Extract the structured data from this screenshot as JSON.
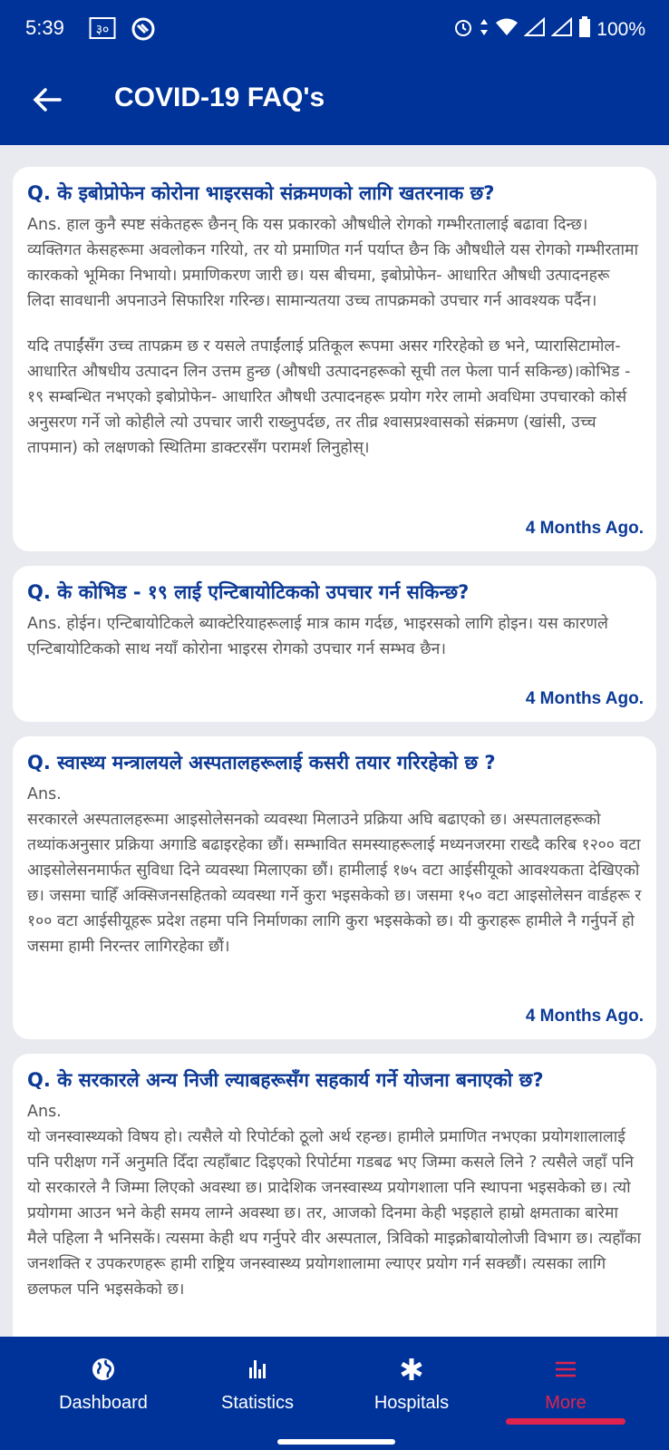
{
  "status": {
    "time": "5:39",
    "battery": "100%"
  },
  "appbar": {
    "title": "COVID-19 FAQ's"
  },
  "faqs": [
    {
      "question": "Q. के इबोप्रोफेन कोरोना भाइरसको संक्रमणको लागि खतरनाक छ?",
      "paragraphs": [
        "Ans. हाल कुनै स्पष्ट संकेतहरू छैनन् कि यस प्रकारको औषधीले रोगको गम्भीरतालाई बढावा दिन्छ। व्यक्तिगत केसहरूमा अवलोकन गरियो, तर यो प्रमाणित गर्न पर्याप्त छैन कि औषधीले यस रोगको गम्भीरतामा कारकको भूमिका निभायो। प्रमाणिकरण जारी छ। यस बीचमा, इबोप्रोफेन- आधारित औषधी उत्पादनहरू लिदा सावधानी अपनाउने सिफारिश गरिन्छ। सामान्यतया उच्च तापक्रमको उपचार गर्न आवश्यक पर्दैन।",
        "यदि तपाईंसँग उच्च तापक्रम छ र यसले तपाईंलाई प्रतिकूल रूपमा असर गरिरहेको छ भने, प्यारासिटामोल-आधारित औषधीय उत्पादन लिन उत्तम हुन्छ (औषधी उत्पादनहरूको सूची तल फेला पार्न सकिन्छ)।कोभिड - १९ सम्बन्धित नभएको इबोप्रोफेन- आधारित औषधी उत्पादनहरू प्रयोग गरेर लामो अवधिमा उपचारको कोर्स अनुसरण गर्ने जो कोहीले त्यो उपचार जारी राख्नुपर्दछ, तर तीव्र श्वासप्रश्वासको संक्रमण (खांसी, उच्च तापमान) को लक्षणको स्थितिमा डाक्टरसँग परामर्श लिनुहोस्।"
      ],
      "time_ago": "4 Months Ago."
    },
    {
      "question": "Q. के कोभिड - १९ लाई एन्टिबायोटिकको उपचार गर्न सकिन्छ?",
      "paragraphs": [
        "Ans. होईन। एन्टिबायोटिकले ब्याक्टेरियाहरूलाई मात्र काम गर्दछ, भाइरसको लागि होइन। यस कारणले एन्टिबायोटिकको साथ नयाँ कोरोना भाइरस रोगको उपचार गर्न सम्भव छैन।"
      ],
      "time_ago": "4 Months Ago."
    },
    {
      "question": "Q. स्वास्थ्य मन्त्रालयले अस्पतालहरूलाई कसरी तयार गरिरहेको छ ?",
      "answer_label": "Ans.",
      "paragraphs": [
        "सरकारले अस्पतालहरूमा आइसोलेसनको व्यवस्था मिलाउने प्रक्रिया अघि बढाएको छ। अस्पतालहरूको तथ्यांकअनुसार प्रक्रिया अगाडि बढाइरहेका छौं। सम्भावित समस्याहरूलाई मध्यनजरमा राख्दै करिब १२०० वटा आइसोलेसनमार्फत सुविधा दिने व्यवस्था मिलाएका छौं। हामीलाई १७५ वटा आईसीयूको आवश्यकता देखिएको छ। जसमा चाहिँ अक्सिजनसहितको व्यवस्था गर्ने कुरा भइसकेको छ। जसमा १५० वटा आइसोलेसन वार्डहरू र १०० वटा आईसीयूहरू प्रदेश तहमा पनि निर्माणका लागि कुरा भइसकेको छ। यी कुराहरू हामीले नै गर्नुपर्ने हो जसमा हामी निरन्तर लागिरहेका छौं।"
      ],
      "time_ago": "4 Months Ago."
    },
    {
      "question": "Q. के सरकारले अन्य निजी ल्याबहरूसँग सहकार्य गर्ने योजना बनाएको छ?",
      "answer_label": "Ans.",
      "paragraphs": [
        "यो जनस्वास्थ्यको विषय हो। त्यसैले यो रिपोर्टको ठूलो अर्थ रहन्छ। हामीले प्रमाणित नभएका प्रयोगशालालाई पनि परीक्षण गर्ने अनुमति दिँदा त्यहाँबाट दिइएको रिपोर्टमा गडबढ भए जिम्मा कसले लिने ? त्यसैले जहाँ पनि यो सरकारले नै जिम्मा लिएको अवस्था छ। प्रादेशिक जनस्वास्थ्य प्रयोगशाला पनि स्थापना भइसकेको छ। त्यो प्रयोगमा आउन भने केही समय लाग्ने अवस्था छ। तर, आजको दिनमा केही भइहाले हाम्रो क्षमताका बारेमा मैले पहिला नै भनिसकें। त्यसमा केही थप गर्नुपरे वीर अस्पताल, त्रिविको माइक्रोबायोलोजी विभाग छ। त्यहाँका जनशक्ति र उपकरणहरू हामी राष्ट्रिय जनस्वास्थ्य प्रयोगशालामा ल्याएर प्रयोग गर्न सक्छौं। त्यसका लागि छलफल पनि भइसकेको छ।"
      ]
    }
  ],
  "nav": [
    {
      "label": "Dashboard",
      "icon": "globe-icon"
    },
    {
      "label": "Statistics",
      "icon": "bar-chart-icon"
    },
    {
      "label": "Hospitals",
      "icon": "asterisk-icon"
    },
    {
      "label": "More",
      "icon": "menu-icon",
      "active": true
    }
  ],
  "colors": {
    "primary": "#003399",
    "accent": "#e0234e"
  }
}
